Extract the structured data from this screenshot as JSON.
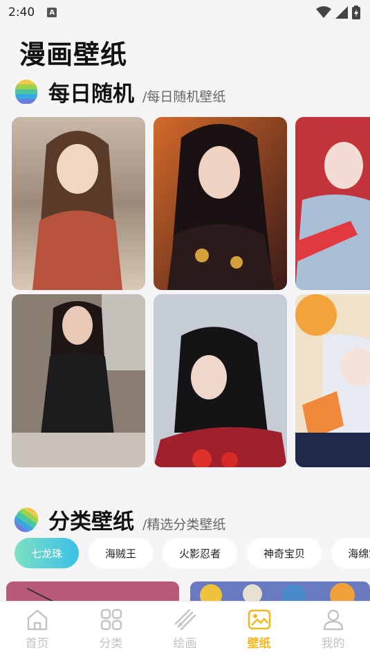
{
  "status": {
    "time": "2:40",
    "notif": "A"
  },
  "page": {
    "title": "漫画壁纸"
  },
  "section_daily": {
    "title": "每日随机",
    "subtitle": "/每日随机壁纸"
  },
  "section_category": {
    "title": "分类壁纸",
    "subtitle": "/精选分类壁纸"
  },
  "categories": [
    "七龙珠",
    "海贼王",
    "火影忍者",
    "神奇宝贝",
    "海绵宝宝"
  ],
  "tabs": [
    {
      "label": "首页",
      "icon": "home-icon"
    },
    {
      "label": "分类",
      "icon": "grid-icon"
    },
    {
      "label": "绘画",
      "icon": "paint-icon"
    },
    {
      "label": "壁纸",
      "icon": "image-icon"
    },
    {
      "label": "我的",
      "icon": "user-icon"
    }
  ],
  "colors": {
    "accent": "#f4b81f",
    "inactive": "#c2c2c2",
    "chip_gradient_start": "#7ee0c4",
    "chip_gradient_end": "#3ac0e8"
  }
}
